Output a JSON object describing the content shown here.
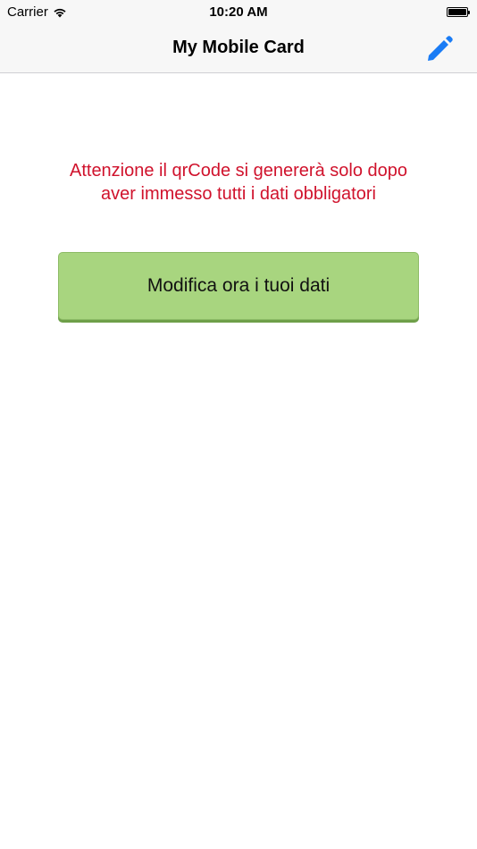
{
  "status_bar": {
    "carrier": "Carrier",
    "time": "10:20 AM",
    "wifi_icon": "wifi-icon",
    "battery_icon": "battery-icon"
  },
  "nav": {
    "title": "My Mobile Card",
    "edit_icon": "pencil-icon",
    "accent_color": "#1a7cf5"
  },
  "main": {
    "warning_line_1": "Attenzione il qrCode si genererà solo dopo",
    "warning_line_2": "aver immesso tutti i dati obbligatori",
    "warning_color": "#d0122c",
    "button_label": "Modifica ora i tuoi dati",
    "button_color": "#a8d57f"
  }
}
